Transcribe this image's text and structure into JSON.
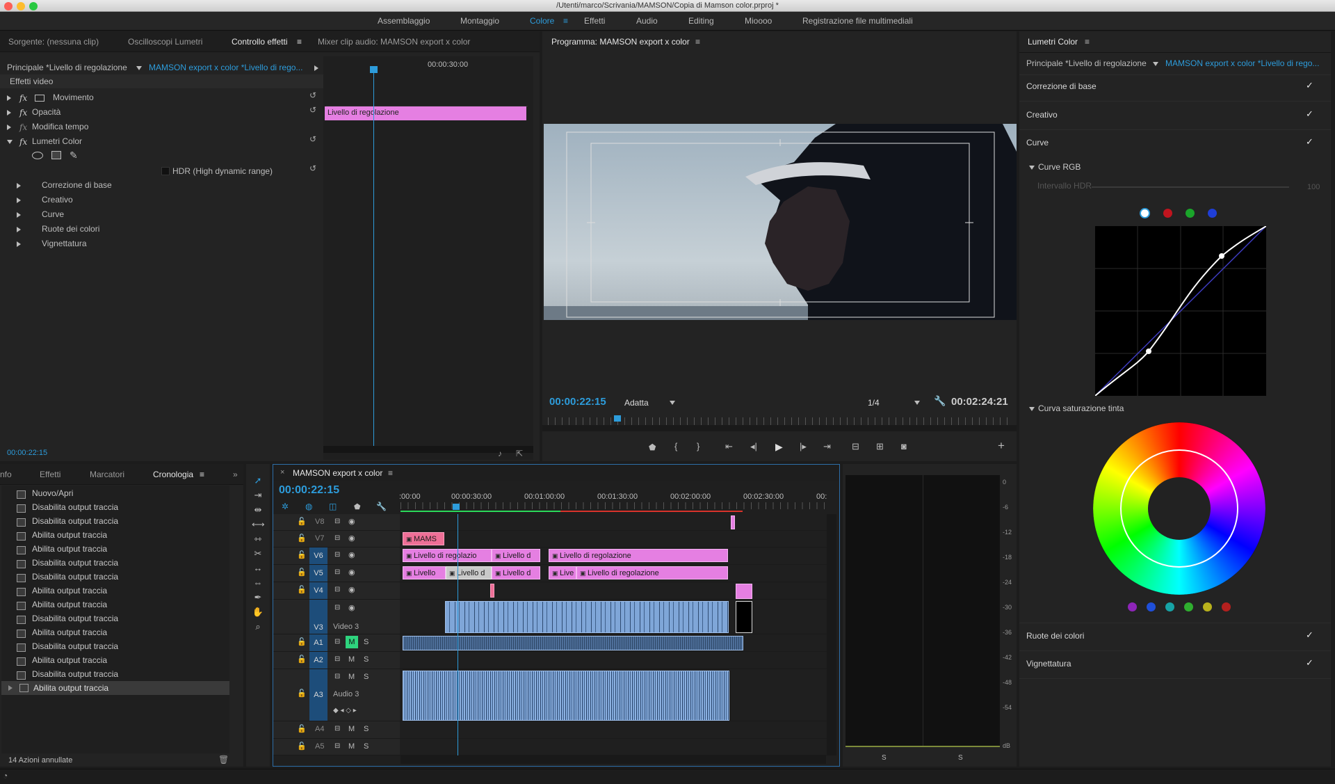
{
  "window": {
    "title": "/Utenti/marco/Scrivania/MAMSON/Copia di Mamson color.prproj *"
  },
  "workspaces": [
    "Assemblaggio",
    "Montaggio",
    "Colore",
    "Effetti",
    "Audio",
    "Editing",
    "Mioooo",
    "Registrazione file multimediali"
  ],
  "effect_panel": {
    "tabs": [
      "Sorgente: (nessuna clip)",
      "Oscilloscopi Lumetri",
      "Controllo effetti",
      "Mixer clip audio: MAMSON export x color"
    ],
    "master": "Principale *Livello di regolazione",
    "sequence": "MAMSON export x color *Livello di rego...",
    "ruler_time": "00:00:30:00",
    "clip_label": "Livello di regolazione",
    "section": "Effetti video",
    "effects": [
      "Movimento",
      "Opacità",
      "Modifica tempo",
      "Lumetri Color"
    ],
    "hdr_label": "HDR (High dynamic range)",
    "subs": [
      "Correzione di base",
      "Creativo",
      "Curve",
      "Ruote dei colori",
      "Vignettatura"
    ],
    "timecode": "00:00:22:15"
  },
  "program": {
    "title": "Programma: MAMSON export x color",
    "timecode": "00:00:22:15",
    "fit": "Adatta",
    "resolution": "1/4",
    "duration": "00:02:24:21"
  },
  "lumetri": {
    "title": "Lumetri Color",
    "master": "Principale *Livello di regolazione",
    "sequence": "MAMSON export x color *Livello di rego...",
    "sections_top": [
      "Correzione di base",
      "Creativo",
      "Curve"
    ],
    "curve_rgb": "Curve RGB",
    "hdr_range": "Intervallo HDR",
    "hdr_value": "100",
    "hue_sat": "Curva saturazione tinta",
    "sections_bottom": [
      "Ruote dei colori",
      "Vignettatura"
    ],
    "channel_colors": [
      "#ffffff",
      "#c0141e",
      "#1aa52a",
      "#1f3ed6"
    ],
    "swatch_colors": [
      "#8e25b8",
      "#1f4fd8",
      "#17a3a6",
      "#2fae2f",
      "#b8b11c",
      "#b4201e"
    ]
  },
  "history": {
    "tabs": [
      "nfo",
      "Effetti",
      "Marcatori",
      "Cronologia"
    ],
    "items": [
      "Nuovo/Apri",
      "Disabilita output traccia",
      "Disabilita output traccia",
      "Abilita output traccia",
      "Abilita output traccia",
      "Disabilita output traccia",
      "Disabilita output traccia",
      "Abilita output traccia",
      "Abilita output traccia",
      "Disabilita output traccia",
      "Abilita output traccia",
      "Disabilita output traccia",
      "Abilita output traccia",
      "Disabilita output traccia",
      "Abilita output traccia"
    ],
    "footer": "14 Azioni annullate"
  },
  "timeline": {
    "title": "MAMSON export x color",
    "timecode": "00:00:22:15",
    "ruler": [
      ":00:00",
      "00:00:30:00",
      "00:01:00:00",
      "00:01:30:00",
      "00:02:00:00",
      "00:02:30:00",
      "00:"
    ],
    "tracks": [
      "V8",
      "V7",
      "V6",
      "V5",
      "V4",
      "V3",
      "A1",
      "A2",
      "A3",
      "A4",
      "A5"
    ],
    "v3_name": "Video 3",
    "a3_name": "Audio 3",
    "clips": {
      "v7": "MAMS",
      "v6a": "Livello di regolazio",
      "v6b": "Livello d",
      "v6c": "Livello di regolazione",
      "v5a": "Livello",
      "v5b": "Livello d",
      "v5c": "Livello d",
      "v5d": "Live",
      "v5e": "Livello di regolazione"
    }
  },
  "meters": {
    "scale": [
      "0",
      "-6",
      "-12",
      "-18",
      "-24",
      "-30",
      "-36",
      "-42",
      "-48",
      "-54",
      "dB"
    ],
    "solo": "S"
  }
}
